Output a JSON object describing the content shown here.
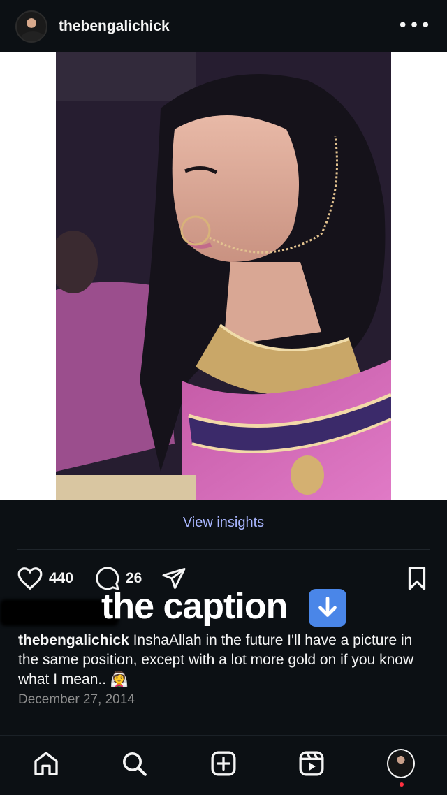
{
  "header": {
    "username": "thebengalichick",
    "more_label": "•••"
  },
  "post": {
    "view_insights_label": "View insights",
    "likes_count": "440",
    "comments_count": "26",
    "overlay_caption": "the caption",
    "caption_username": "thebengalichick",
    "caption_text": "InshaAllah in the future I'll have a picture in the same position, except with a lot more gold on if you know what I mean.. 👰",
    "date": "December 27, 2014"
  },
  "icons": {
    "like": "heart-icon",
    "comment": "comment-icon",
    "share": "send-icon",
    "save": "bookmark-icon",
    "caption_arrow": "down-arrow-icon"
  },
  "tabbar": {
    "items": [
      "home-icon",
      "search-icon",
      "create-icon",
      "reels-icon",
      "profile-avatar"
    ]
  },
  "colors": {
    "background": "#0c1014",
    "link": "#a9b6ff",
    "muted": "#8e8e8e",
    "notification": "#ff3040"
  }
}
